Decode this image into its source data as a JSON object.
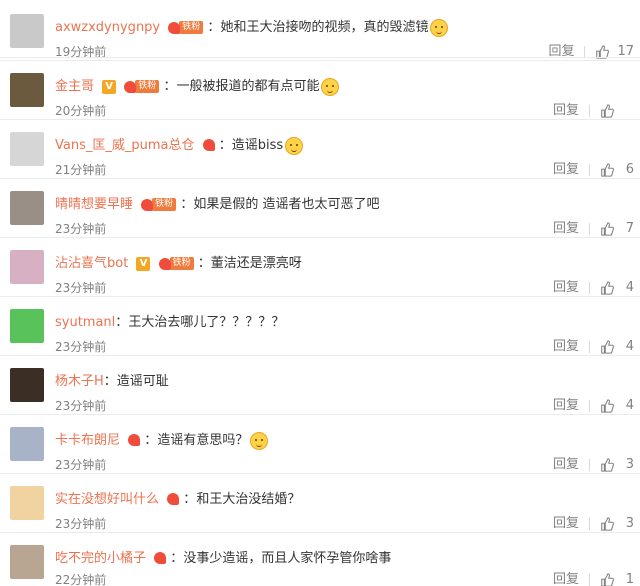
{
  "comments": [
    {
      "username": "axwzxdynygnpy",
      "vip": false,
      "fan_label": "铁粉",
      "text": "她和王大治接吻的视频，真的毁滤镜",
      "emoji": true,
      "time": "19分钟前",
      "reply": "回复",
      "likes": "17",
      "avatar_color": "#c9c9c9"
    },
    {
      "username": "金主哥",
      "vip": true,
      "fan_label": "铁粉",
      "text": "一般被报道的都有点可能",
      "emoji": true,
      "time": "20分钟前",
      "reply": "回复",
      "likes": "",
      "avatar_color": "#6b5a3e"
    },
    {
      "username": "Vans_匡_威_puma总仓",
      "vip": false,
      "fan_label": "",
      "text": "造谣biss",
      "emoji": true,
      "time": "21分钟前",
      "reply": "回复",
      "likes": "6",
      "avatar_color": "#d6d6d6"
    },
    {
      "username": "晴晴想要早睡",
      "vip": false,
      "fan_label": "铁粉",
      "text": "如果是假的 造谣者也太可恶了吧",
      "emoji": false,
      "time": "23分钟前",
      "reply": "回复",
      "likes": "7",
      "avatar_color": "#9a8f86"
    },
    {
      "username": "沾沾喜气bot",
      "vip": true,
      "fan_label": "铁粉",
      "text": "董洁还是漂亮呀",
      "emoji": false,
      "time": "23分钟前",
      "reply": "回复",
      "likes": "4",
      "avatar_color": "#d7b0c4"
    },
    {
      "username": "syutmanl",
      "vip": false,
      "fan_label": "",
      "text": "王大治去哪儿了？？？？？",
      "emoji": false,
      "time": "23分钟前",
      "reply": "回复",
      "likes": "4",
      "avatar_color": "#59c25a"
    },
    {
      "username": "杨木子H",
      "vip": false,
      "fan_label": "",
      "text": "造谣可耻",
      "emoji": false,
      "time": "23分钟前",
      "reply": "回复",
      "likes": "4",
      "avatar_color": "#3a2e25"
    },
    {
      "username": "卡卡布朗尼",
      "vip": false,
      "fan_label": "",
      "text": "造谣有意思吗？",
      "emoji": true,
      "time": "23分钟前",
      "reply": "回复",
      "likes": "3",
      "avatar_color": "#a8b3c7"
    },
    {
      "username": "实在没想好叫什么",
      "vip": false,
      "fan_label": "",
      "text": "和王大治没结婚？",
      "emoji": false,
      "time": "23分钟前",
      "reply": "回复",
      "likes": "3",
      "avatar_color": "#f0d3a0"
    },
    {
      "username": "吃不完的小橘子",
      "vip": false,
      "fan_label": "",
      "text": "没事少造谣，而且人家怀孕管你啥事",
      "emoji": false,
      "time": "22分钟前",
      "reply": "回复",
      "likes": "1",
      "avatar_color": "#b9a692"
    }
  ]
}
